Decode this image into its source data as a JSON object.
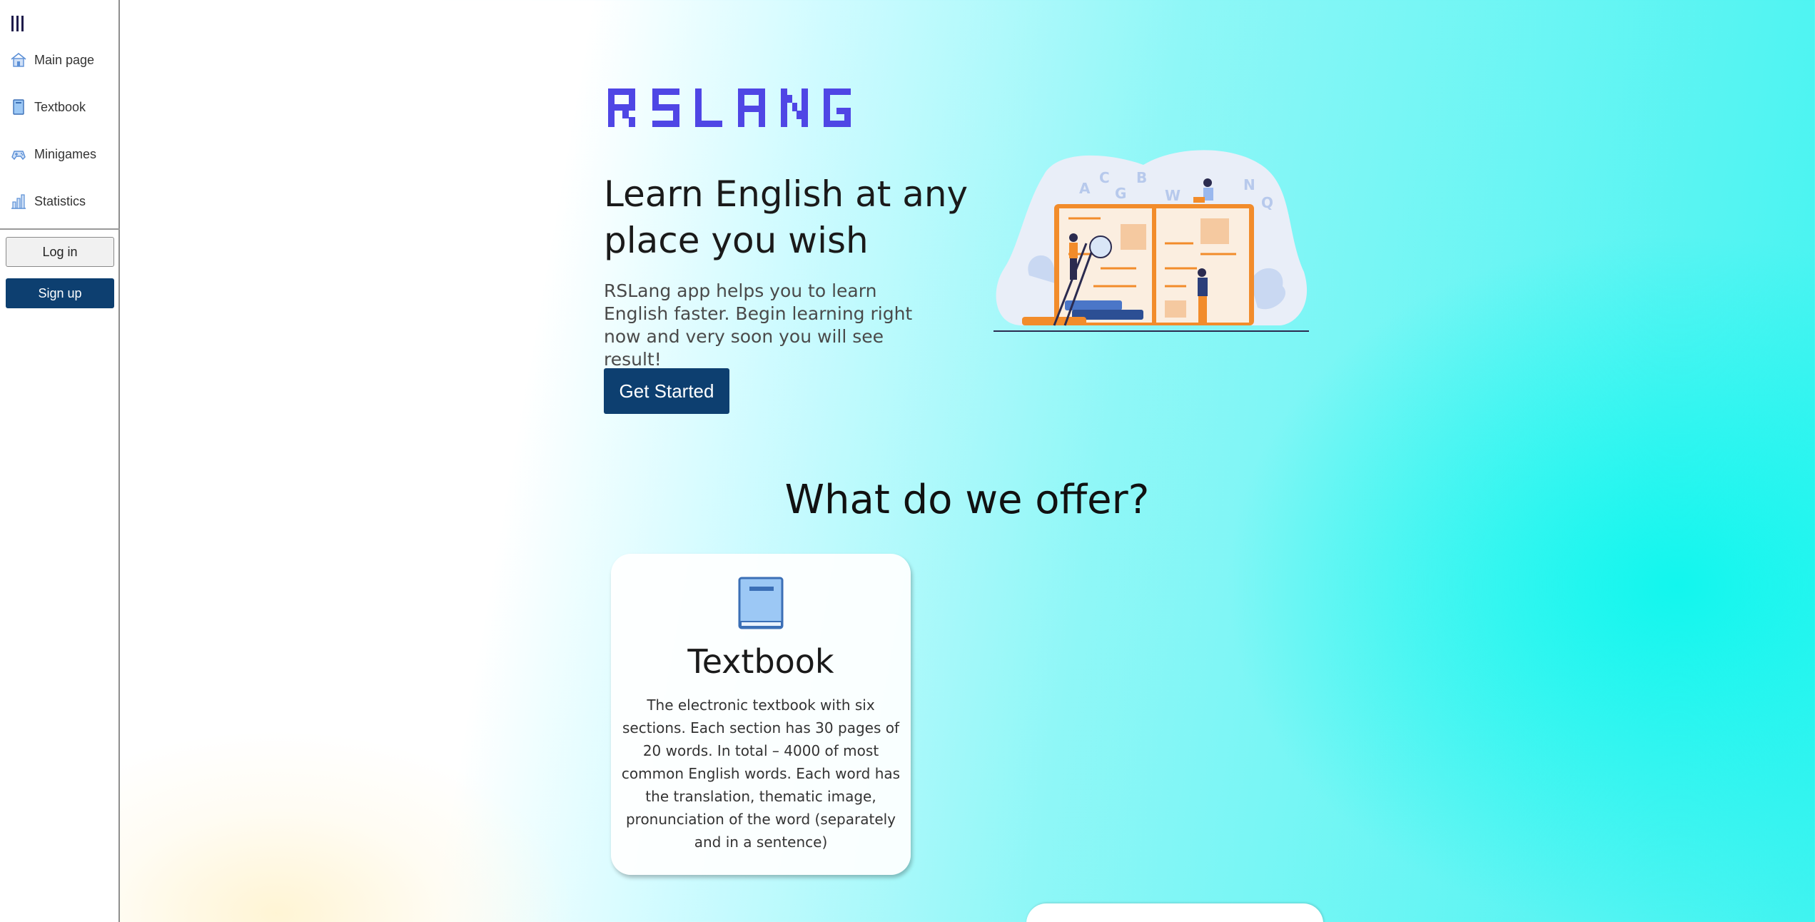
{
  "sidebar": {
    "items": [
      {
        "label": "Main page",
        "icon": "home-icon"
      },
      {
        "label": "Textbook",
        "icon": "book-icon"
      },
      {
        "label": "Minigames",
        "icon": "gamepad-icon"
      },
      {
        "label": "Statistics",
        "icon": "bar-chart-icon"
      }
    ],
    "login_label": "Log in",
    "signup_label": "Sign up"
  },
  "hero": {
    "logo_text": "RSLANG",
    "title": "Learn English at any place you wish",
    "description": "RSLang app helps you to learn English faster. Begin learning right now and very soon you will see result!",
    "cta_label": "Get Started"
  },
  "offers": {
    "title": "What do we offer?",
    "cards": [
      {
        "title": "Textbook",
        "icon": "book-icon",
        "text": "The electronic textbook with six sections. Each section has 30 pages of 20 words. In total – 4000 of most common English words. Each word has the translation, thematic image, pronunciation of the word (separately and in a sentence)"
      }
    ]
  },
  "colors": {
    "brand_purple": "#4f46e5",
    "primary_button": "#0d3f70",
    "accent_orange": "#f28c2b"
  }
}
